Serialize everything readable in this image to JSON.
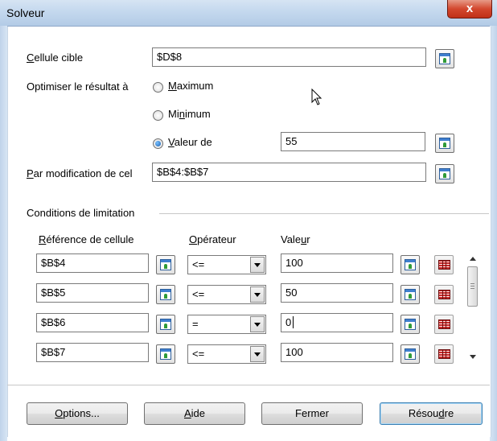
{
  "window": {
    "title": "Solveur",
    "close_glyph": "x"
  },
  "target": {
    "label_u": "C",
    "label_rest": "ellule cible",
    "value": "$D$8"
  },
  "optimize": {
    "label": "Optimiser le résultat à",
    "maximum": {
      "u": "M",
      "rest": "aximum",
      "selected": false
    },
    "minimum": {
      "pre": "Mi",
      "u": "n",
      "rest": "imum",
      "selected": false
    },
    "valueof": {
      "u": "V",
      "rest": "aleur de",
      "selected": true,
      "value": "55"
    }
  },
  "modify": {
    "label_u": "P",
    "label_rest": "ar modification de cel",
    "value": "$B$4:$B$7"
  },
  "constraints": {
    "title": "Conditions de limitation",
    "col_ref": {
      "u": "R",
      "rest": "éférence de cellule"
    },
    "col_op": {
      "u": "O",
      "rest": "pérateur"
    },
    "col_val": {
      "pre": "Vale",
      "u": "u",
      "rest": "r"
    },
    "rows": [
      {
        "ref": "$B$4",
        "op": "<=",
        "value": "100"
      },
      {
        "ref": "$B$5",
        "op": "<=",
        "value": "50"
      },
      {
        "ref": "$B$6",
        "op": "=",
        "value": "0"
      },
      {
        "ref": "$B$7",
        "op": "<=",
        "value": "100"
      }
    ]
  },
  "buttons": {
    "options": {
      "u": "O",
      "rest": "ptions..."
    },
    "help": {
      "u": "A",
      "rest": "ide"
    },
    "close": "Fermer",
    "solve": {
      "pre": "Résou",
      "u": "d",
      "rest": "re"
    }
  },
  "icons": {
    "ref_button": "shrink-window-icon",
    "remove_button": "table-grid-icon",
    "cursor": "mouse-pointer-icon"
  }
}
